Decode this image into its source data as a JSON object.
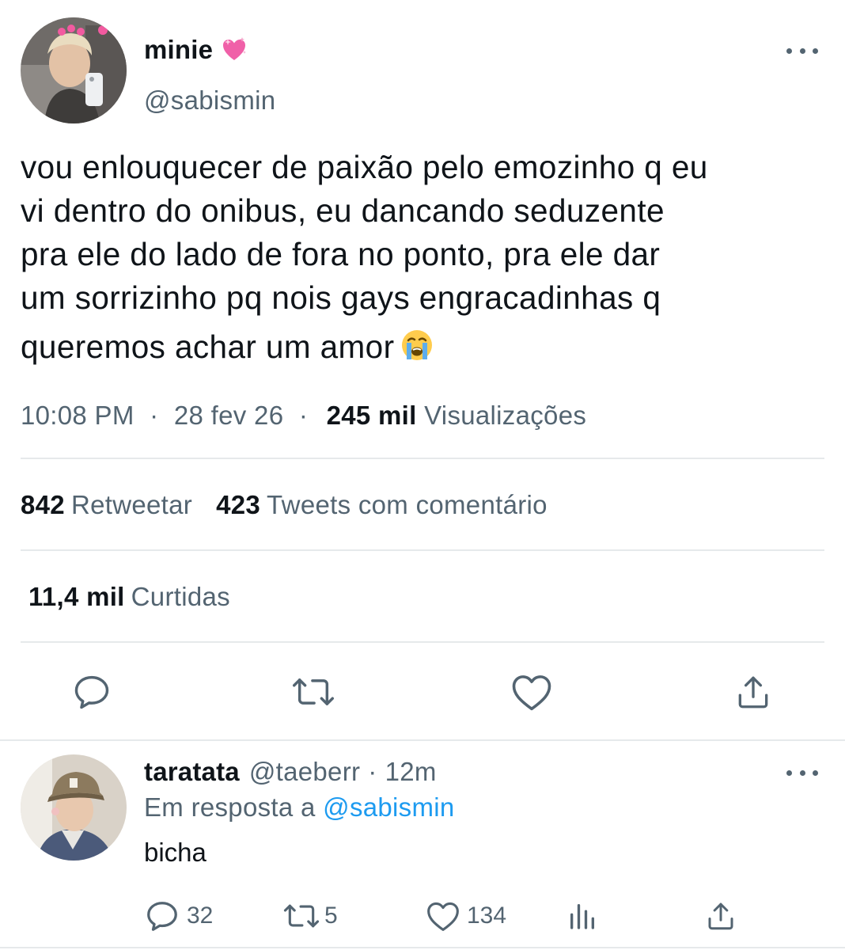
{
  "tweet": {
    "author_name": "minie",
    "author_emoji": "heart-with-sparkles",
    "author_handle": "@sabismin",
    "text_lines": [
      "vou enlouquecer de paixão pelo emozinho q eu",
      "vi dentro do onibus, eu dancando seduzente",
      "pra ele do lado de fora no ponto, pra ele dar",
      "um sorrizinho pq nois gays engracadinhas q",
      "queremos achar um amor"
    ],
    "text_end_emoji": "loudly-crying-face",
    "time": "10:08 PM",
    "sep1": "·",
    "date": "28 fev 26",
    "sep2": "·",
    "views_count": "245 mil",
    "views_label": "Visualizações",
    "retweets_count": "842",
    "retweets_label": "Retweetar",
    "quotes_count": "423",
    "quotes_label": "Tweets com comentário",
    "likes_count": "11,4 mil",
    "likes_label": "Curtidas"
  },
  "actions": [
    "reply-icon",
    "retweet-icon",
    "like-icon",
    "share-icon"
  ],
  "reply": {
    "author_name": "taratata",
    "author_handle": "@taeberr",
    "sep": "·",
    "time": "12m",
    "in_reply_prefix": "Em resposta a",
    "in_reply_handle": "@sabismin",
    "text": "bicha",
    "reply_count": "32",
    "retweet_count": "5",
    "like_count": "134"
  },
  "colors": {
    "text": "#0f1419",
    "secondary": "#536471",
    "link": "#1d9bf0",
    "divider": "#e6e9eb",
    "heart_pink": "#f060a8"
  }
}
